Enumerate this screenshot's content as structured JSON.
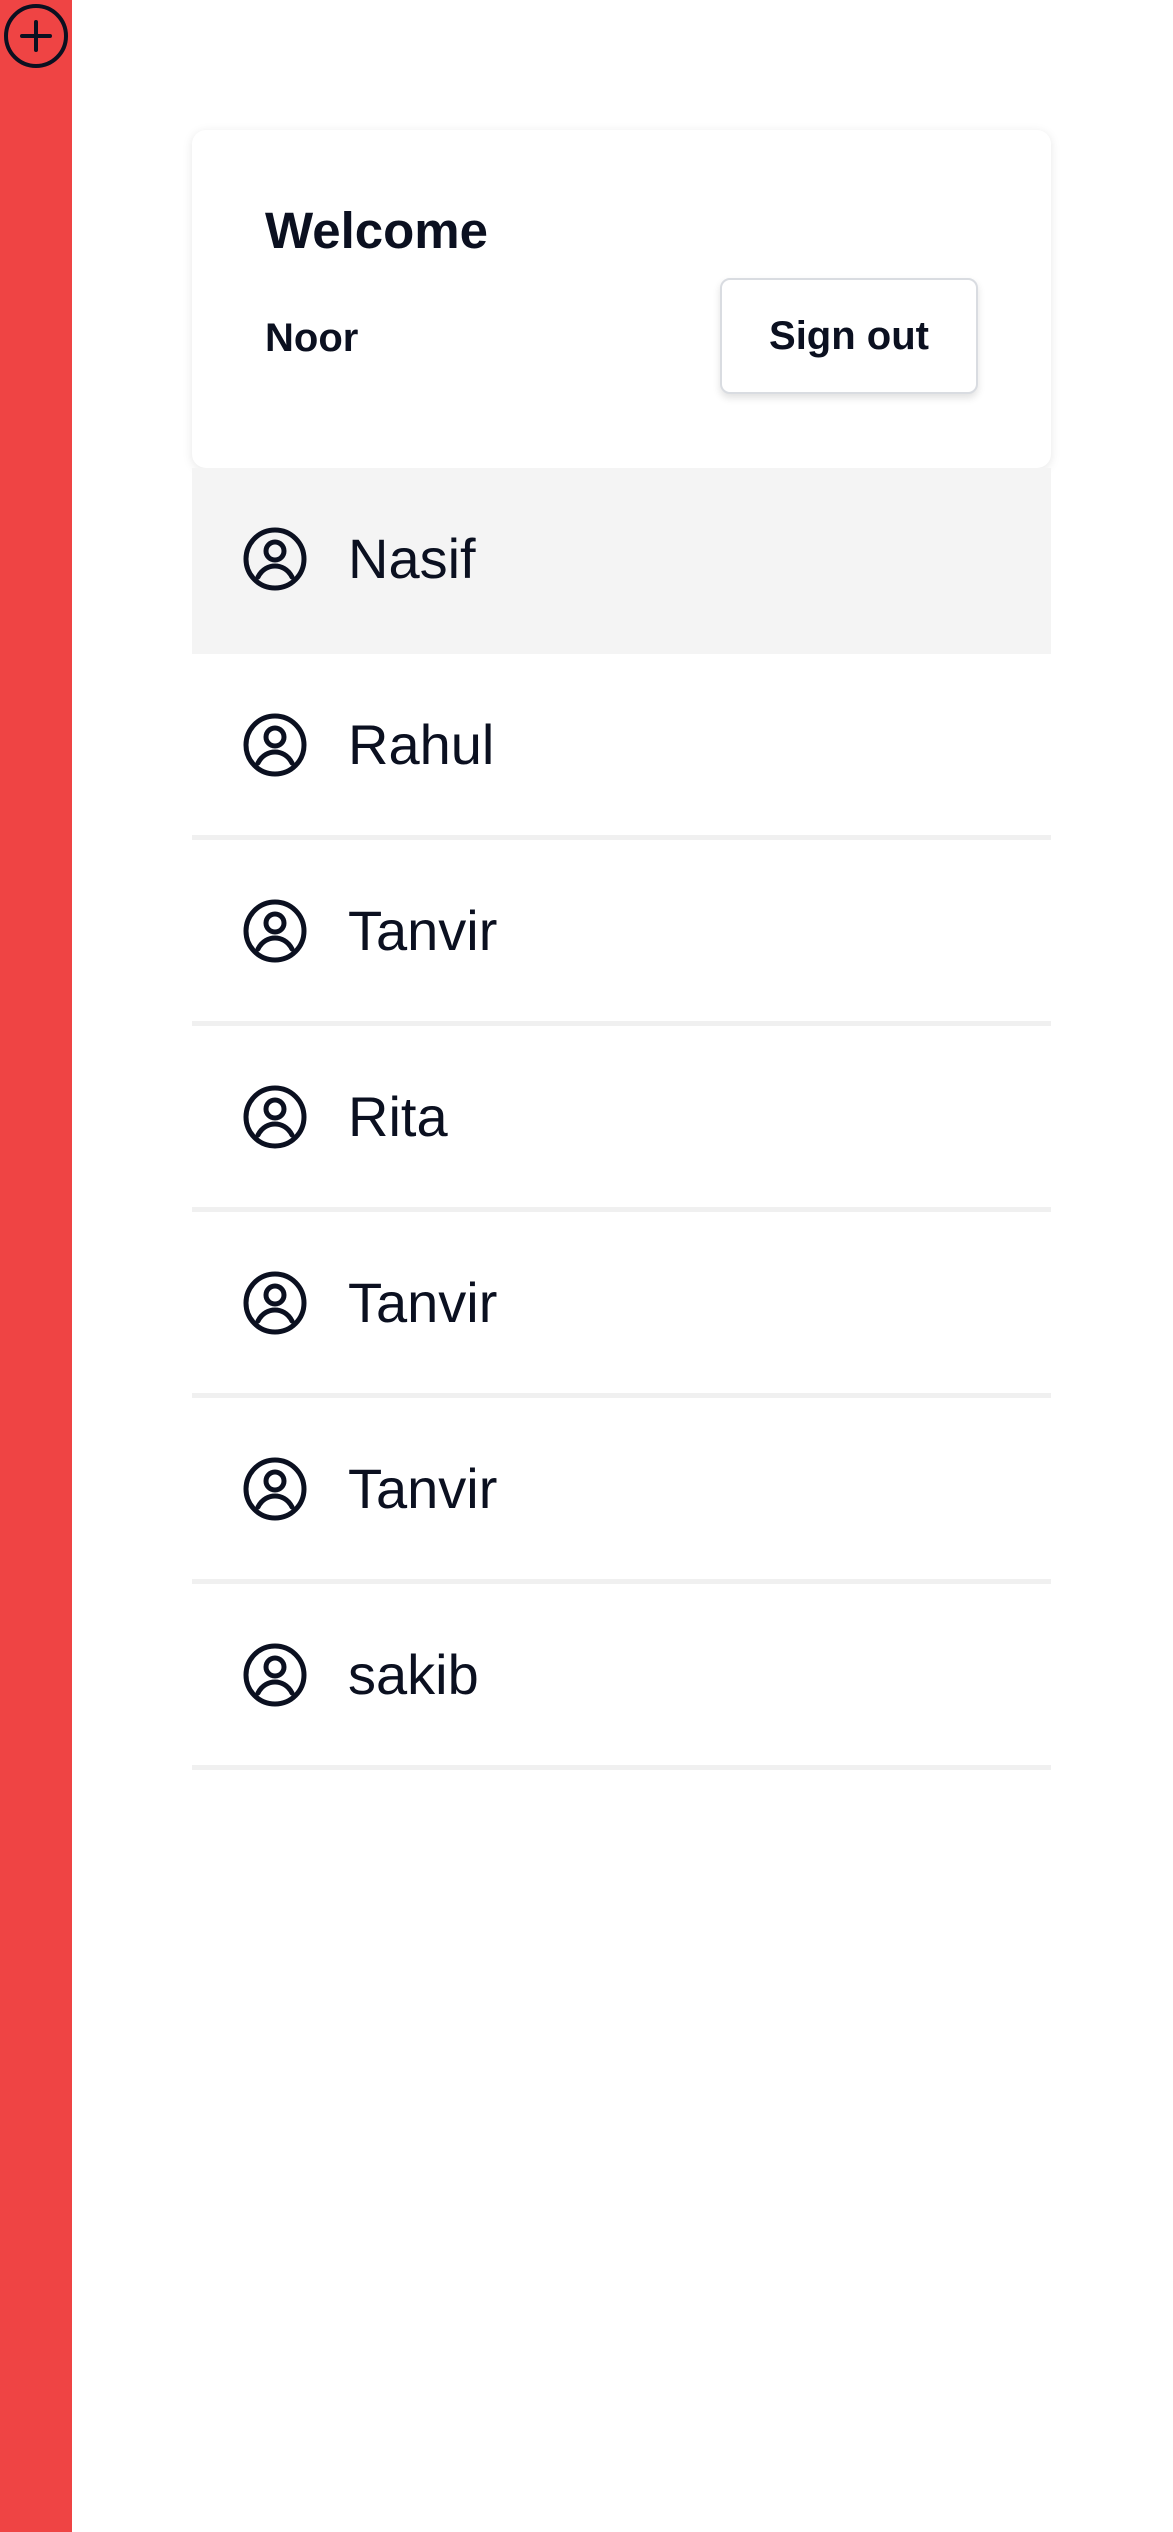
{
  "app": {
    "accent_color": "#ef4444",
    "add_icon": "plus-circle-icon"
  },
  "welcome": {
    "title": "Welcome",
    "user_name": "Noor",
    "sign_out_label": "Sign out"
  },
  "contacts": [
    {
      "name": "Nasif",
      "icon": "user-circle-icon",
      "selected": true
    },
    {
      "name": "Rahul",
      "icon": "user-circle-icon",
      "selected": false
    },
    {
      "name": "Tanvir",
      "icon": "user-circle-icon",
      "selected": false
    },
    {
      "name": "Rita",
      "icon": "user-circle-icon",
      "selected": false
    },
    {
      "name": "Tanvir",
      "icon": "user-circle-icon",
      "selected": false
    },
    {
      "name": "Tanvir",
      "icon": "user-circle-icon",
      "selected": false
    },
    {
      "name": "sakib",
      "icon": "user-circle-icon",
      "selected": false
    }
  ]
}
